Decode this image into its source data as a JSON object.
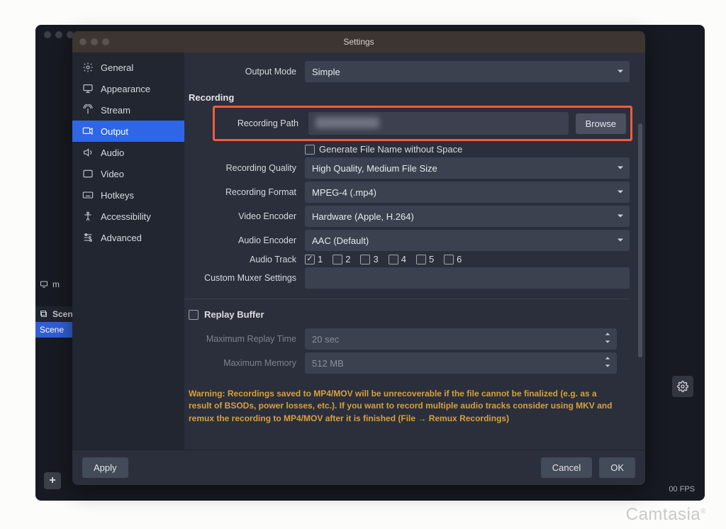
{
  "window": {
    "title": "Settings"
  },
  "sidebar": {
    "items": [
      {
        "label": "General"
      },
      {
        "label": "Appearance"
      },
      {
        "label": "Stream"
      },
      {
        "label": "Output"
      },
      {
        "label": "Audio"
      },
      {
        "label": "Video"
      },
      {
        "label": "Hotkeys"
      },
      {
        "label": "Accessibility"
      },
      {
        "label": "Advanced"
      }
    ]
  },
  "form": {
    "outputMode": {
      "label": "Output Mode",
      "value": "Simple"
    },
    "recordingHeader": "Recording",
    "recordingPath": {
      "label": "Recording Path",
      "browse": "Browse"
    },
    "genFilename": {
      "label": "Generate File Name without Space",
      "checked": false
    },
    "recordingQuality": {
      "label": "Recording Quality",
      "value": "High Quality, Medium File Size"
    },
    "recordingFormat": {
      "label": "Recording Format",
      "value": "MPEG-4 (.mp4)"
    },
    "videoEncoder": {
      "label": "Video Encoder",
      "value": "Hardware (Apple, H.264)"
    },
    "audioEncoder": {
      "label": "Audio Encoder",
      "value": "AAC (Default)"
    },
    "audioTrack": {
      "label": "Audio Track",
      "tracks": [
        "1",
        "2",
        "3",
        "4",
        "5",
        "6"
      ],
      "checked": [
        true,
        false,
        false,
        false,
        false,
        false
      ]
    },
    "customMuxer": {
      "label": "Custom Muxer Settings",
      "value": ""
    },
    "replayBuffer": {
      "label": "Replay Buffer",
      "checked": false
    },
    "maxReplayTime": {
      "label": "Maximum Replay Time",
      "value": "20 sec"
    },
    "maxMemory": {
      "label": "Maximum Memory",
      "value": "512 MB"
    },
    "warning": "Warning: Recordings saved to MP4/MOV will be unrecoverable if the file cannot be finalized (e.g. as a result of BSODs, power losses, etc.). If you want to record multiple audio tracks consider using MKV and remux the recording to MP4/MOV after it is finished (File → Remux Recordings)"
  },
  "footer": {
    "apply": "Apply",
    "cancel": "Cancel",
    "ok": "OK"
  },
  "background": {
    "scenesHeader": "Scen",
    "sceneSelected": "Scene",
    "monitor": "m",
    "fps": "00 FPS"
  },
  "watermark": "Camtasia"
}
